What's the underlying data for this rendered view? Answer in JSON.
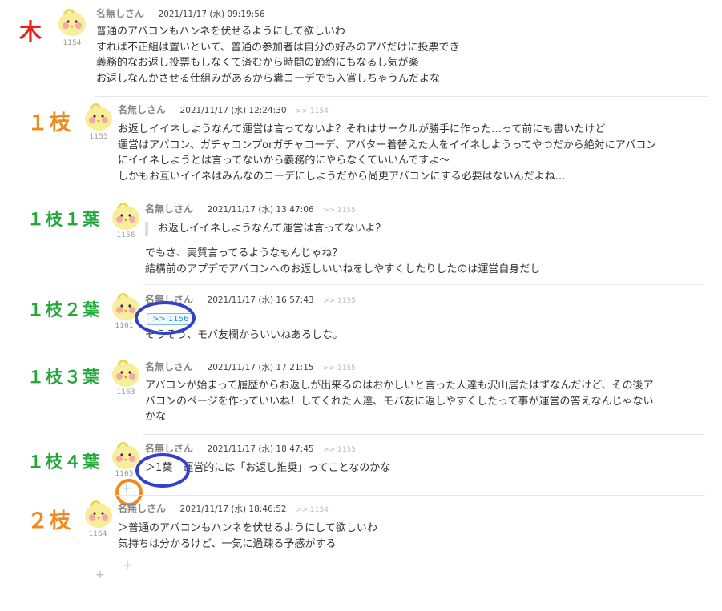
{
  "labels": {
    "tree": "木",
    "branch1": "１枝",
    "b1_leaf1": "１枝１葉",
    "b1_leaf2": "１枝２葉",
    "b1_leaf3": "１枝３葉",
    "b1_leaf4": "１枝４葉",
    "branch2": "２枝"
  },
  "colors": {
    "tree": "#e8211d",
    "branch": "#f08a1c",
    "leaf": "#22a83a",
    "ring": "#3341c8"
  },
  "posts": [
    {
      "num": "1154",
      "name": "名無しさん",
      "time": "2021/11/17 (水) 09:19:56",
      "reply": "",
      "lines": [
        "普通のアバコンもハンネを伏せるようにして欲しいわ",
        "すれば不正組は置いといて、普通の参加者は自分の好みのアバだけに投票でき",
        "義務的なお返し投票もしなくて済むから時間の節約にもなるし気が楽",
        "お返しなんかさせる仕組みがあるから糞コーデでも入賞しちゃうんだよな"
      ]
    },
    {
      "num": "1155",
      "name": "名無しさん",
      "time": "2021/11/17 (水) 12:24:30",
      "reply": ">> 1154",
      "lines": [
        "お返しイイネしようなんて運営は言ってないよ？それはサークルが勝手に作った…って前にも書いたけど",
        "運営はアバコン、ガチャコンプorガチャコーデ、アバター着替えた人をイイネしようってやつだから絶対にアバコン",
        "にイイネしようとは言ってないから義務的にやらなくていいんですよ～",
        "しかもお互いイイネはみんなのコーデにしようだから尚更アバコンにする必要はないんだよね…"
      ]
    },
    {
      "num": "1156",
      "name": "名無しさん",
      "time": "2021/11/17 (水) 13:47:06",
      "reply": ">> 1155",
      "quote": "お返しイイネしようなんて運営は言ってないよ？",
      "lines": [
        "でもさ、実質言ってるようなもんじゃね？",
        "結構前のアプデでアバコンへのお返しいいねをしやすくしたりしたのは運営自身だし"
      ]
    },
    {
      "num": "1161",
      "name": "名無しさん",
      "time": "2021/11/17 (水) 16:57:43",
      "reply": ">> 1155",
      "anchor": ">> 1156",
      "lines": [
        "そうそう、モバ友欄からいいねあるしな。"
      ]
    },
    {
      "num": "1163",
      "name": "名無しさん",
      "time": "2021/11/17 (水) 17:21:15",
      "reply": ">> 1155",
      "lines": [
        "アバコンが始まって履歴からお返しが出来るのはおかしいと言った人達も沢山居たはずなんだけど、その後ア",
        "バコンのページを作っていいね！してくれた人達、モバ友に返しやすくしたって事が運営の答えなんじゃない",
        "かな"
      ]
    },
    {
      "num": "1165",
      "name": "名無しさん",
      "time": "2021/11/17 (水) 18:47:45",
      "reply": ">> 1155",
      "quote_inline": "＞1葉",
      "lines": [
        "運営的には「お返し推奨」ってことなのかな"
      ]
    },
    {
      "num": "1164",
      "name": "名無しさん",
      "time": "2021/11/17 (水) 18:46:52",
      "reply": ">> 1154",
      "lines": [
        "＞普通のアバコンもハンネを伏せるようにして欲しいわ",
        "気持ちは分かるけど、一気に過疎る予感がする"
      ]
    }
  ],
  "icons": {
    "avatar": "bird-avatar-icon",
    "expand": "plus-icon"
  }
}
